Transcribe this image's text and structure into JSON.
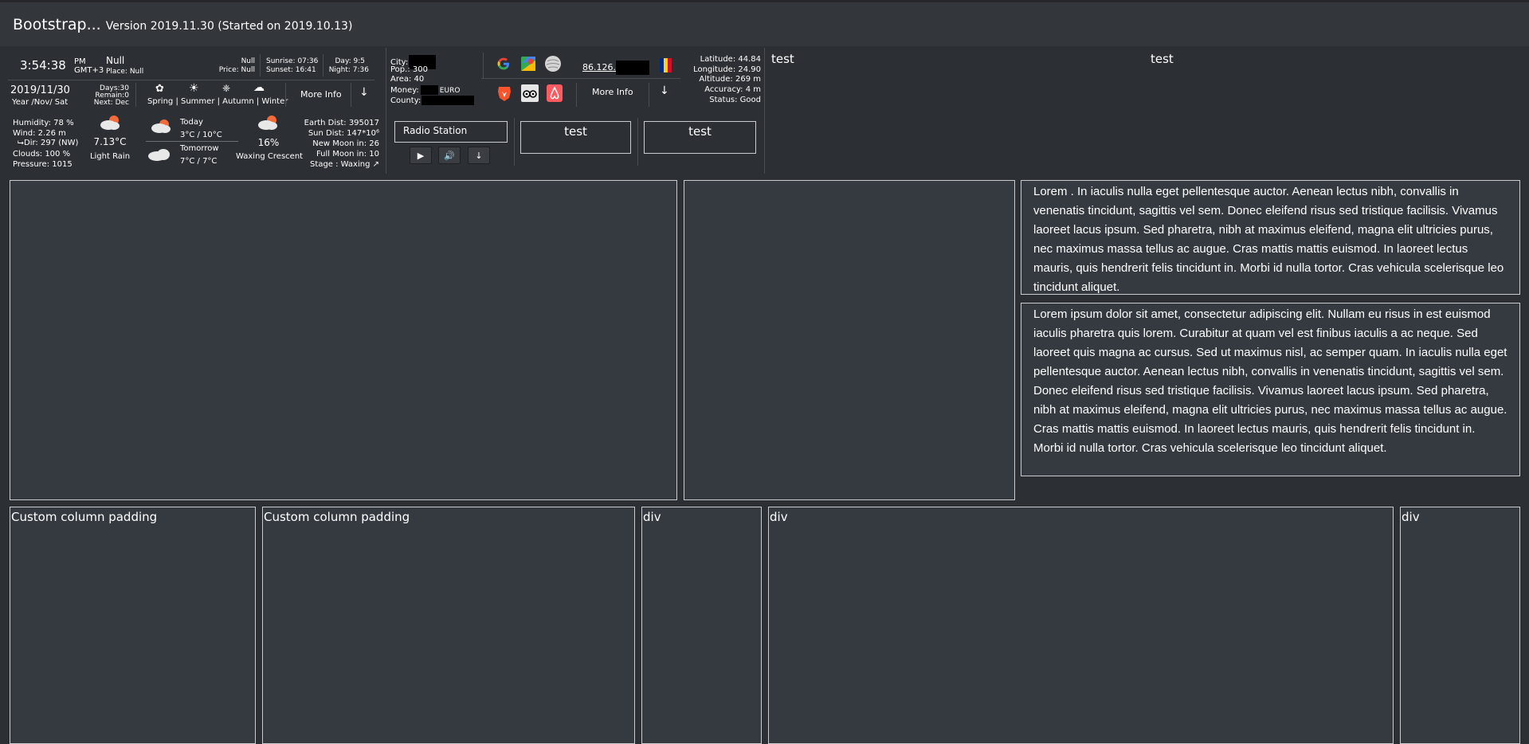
{
  "header": {
    "brand": "Bootstrap...",
    "version": "Version 2019.11.30 (Started on 2019.10.13)"
  },
  "clock": {
    "time": "3:54:38",
    "ampm": "PM",
    "tz": "GMT+3",
    "place_title": "Null",
    "place": "Place: Null",
    "null_small": "Null",
    "price": "Price: Null",
    "sunrise": "Sunrise: 07:36",
    "sunset": "Sunset:  16:41",
    "day": "Day:  9:5",
    "night": "Night: 7:36"
  },
  "calendar": {
    "date": "2019/11/30",
    "sub": "Year /Nov/ Sat",
    "days": "Days:30",
    "remain": "Remain:0",
    "next": "Next: Dec",
    "seasons": "Spring | Summer | Autumn | Winter",
    "more_info": "More Info"
  },
  "weather": {
    "humidity": "Humidity: 78 %",
    "wind": "Wind: 2.26 m",
    "dir": "⮡Dir: 297 (NW)",
    "clouds": "Clouds: 100 %",
    "pressure": "Pressure: 1015",
    "temp": "7.13°C",
    "condition": "Light Rain",
    "today_label": "Today",
    "today_range": "3°C / 10°C",
    "tomorrow_label": "Tomorrow",
    "tomorrow_range": "7°C / 7°C"
  },
  "moon": {
    "percent": "16%",
    "phase": "Waxing Crescent",
    "earth_dist": "Earth Dist: 395017",
    "sun_dist": "Sun Dist: 147*10⁶",
    "new_moon": "New Moon in: 26",
    "full_moon": "Full Moon in: 10",
    "stage": "Stage : Waxing ↗"
  },
  "location": {
    "city": "City:",
    "pop": "Pop.: 300",
    "area": "Area: 40",
    "money": "Money:",
    "money_unit": "EURO",
    "county": "County:",
    "ip": "86.126.",
    "more_info": "More Info",
    "latitude": "Latitude: 44.84",
    "longitude": "Longitude: 24.90",
    "altitude": "Altitude: 269 m",
    "accuracy": "Accuracy: 4 m",
    "status": "Status: Good"
  },
  "radio": {
    "station": "Radio Station"
  },
  "tests": {
    "box1": "test",
    "box2": "test",
    "top_left": "test",
    "top_center": "test"
  },
  "content": {
    "lorem1": "Lorem . In iaculis nulla eget pellentesque auctor. Aenean lectus nibh, convallis in venenatis tincidunt, sagittis vel sem. Donec eleifend risus sed tristique facilisis. Vivamus laoreet lacus ipsum. Sed pharetra, nibh at maximus eleifend, magna elit ultricies purus, nec maximus massa tellus ac augue. Cras mattis mattis euismod. In laoreet lectus mauris, quis hendrerit felis tincidunt in. Morbi id nulla tortor. Cras vehicula scelerisque leo tincidunt aliquet.",
    "lorem2": "Lorem ipsum dolor sit amet, consectetur adipiscing elit. Nullam eu risus in est euismod iaculis pharetra quis lorem. Curabitur at quam vel est finibus iaculis a ac neque. Sed laoreet quis magna ac cursus. Sed ut maximus nisl, ac semper quam. In iaculis nulla eget pellentesque auctor. Aenean lectus nibh, convallis in venenatis tincidunt, sagittis vel sem. Donec eleifend risus sed tristique facilisis. Vivamus laoreet lacus ipsum. Sed pharetra, nibh at maximus eleifend, magna elit ultricies purus, nec maximus massa tellus ac augue. Cras mattis mattis euismod. In laoreet lectus mauris, quis hendrerit felis tincidunt in. Morbi id nulla tortor. Cras vehicula scelerisque leo tincidunt aliquet."
  },
  "bottom": {
    "col1": "Custom column padding",
    "col2": "Custom column padding",
    "col3": "div",
    "col4": "div",
    "col5": "div"
  },
  "colors": {
    "background": "#2c2f33",
    "panel": "#343a40",
    "border": "#c9cbcf",
    "flag": [
      "#002b7f",
      "#fcd116",
      "#ce1126"
    ]
  }
}
